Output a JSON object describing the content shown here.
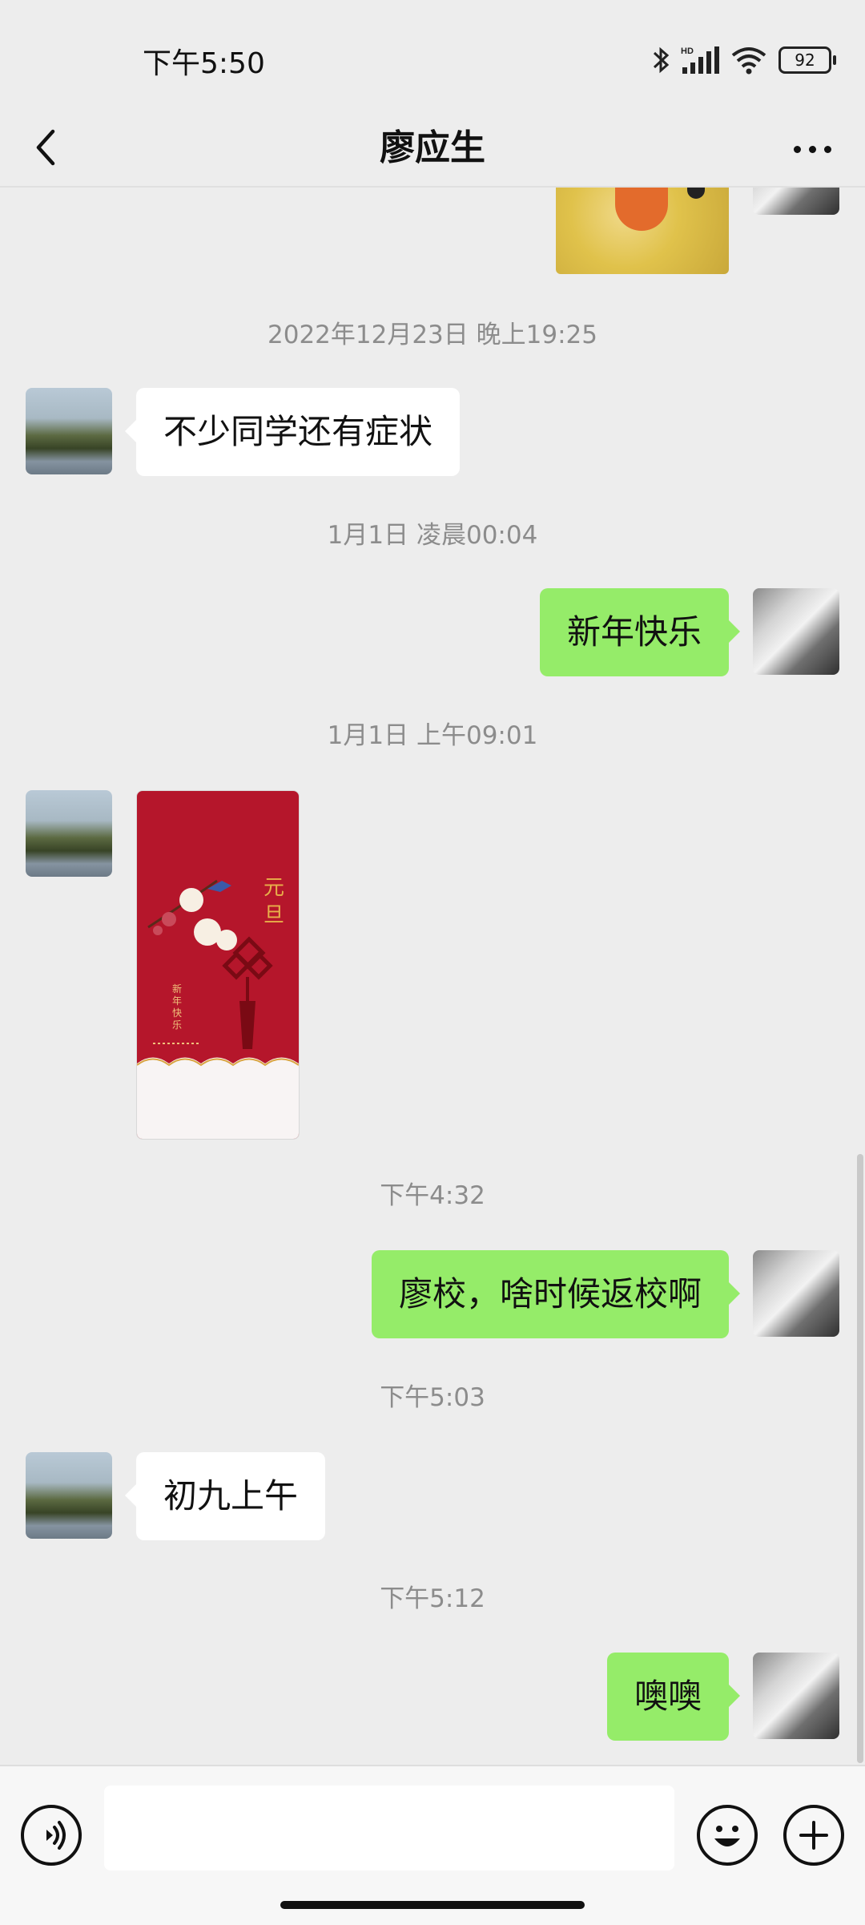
{
  "status_bar": {
    "time": "下午5:50",
    "battery": "92",
    "network": "HD"
  },
  "nav": {
    "title": "廖应生",
    "back_icon": "chevron-left-icon",
    "more_icon": "more-dots-icon"
  },
  "messages": {
    "ts1": "2022年12月23日 晚上19:25",
    "m1": "不少同学还有症状",
    "ts2": "1月1日 凌晨00:04",
    "m2": "新年快乐",
    "ts3": "1月1日 上午09:01",
    "card": {
      "title": "元旦",
      "subtitle": "新年快乐"
    },
    "ts4": "下午4:32",
    "m3": "廖校，啥时候返校啊",
    "ts5": "下午5:03",
    "m4": "初九上午",
    "ts6": "下午5:12",
    "m5": "噢噢"
  },
  "input_bar": {
    "voice_icon": "voice-icon",
    "emoji_icon": "emoji-icon",
    "plus_icon": "plus-icon",
    "placeholder": ""
  },
  "colors": {
    "background": "#ededed",
    "sent_bubble": "#95ec69",
    "received_bubble": "#ffffff",
    "card_red": "#b5162b"
  }
}
